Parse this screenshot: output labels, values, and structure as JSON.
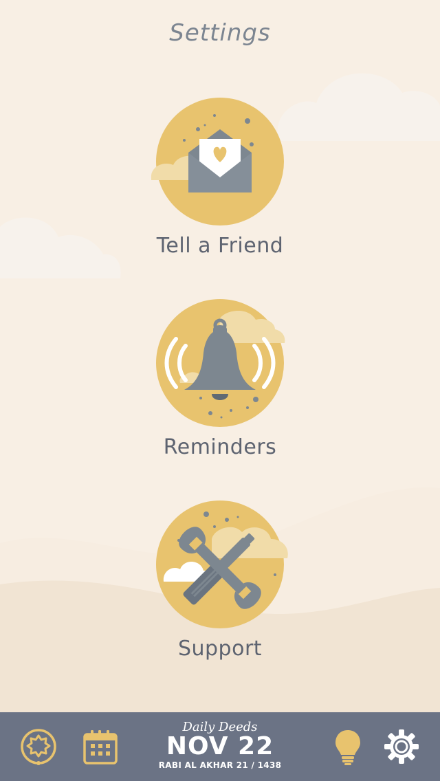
{
  "header": {
    "title": "Settings"
  },
  "menu": [
    {
      "label": "Tell a Friend",
      "icon": "envelope-heart-icon"
    },
    {
      "label": "Reminders",
      "icon": "bell-icon"
    },
    {
      "label": "Support",
      "icon": "wrench-screwdriver-icon"
    }
  ],
  "tabbar": {
    "app_name": "Daily Deeds",
    "date": "NOV 22",
    "hijri": "RABI AL AKHAR 21 / 1438",
    "icons": [
      "badge-icon",
      "calendar-icon",
      "lightbulb-icon",
      "gear-icon"
    ]
  },
  "colors": {
    "background": "#f8efe4",
    "accent": "#e8c36e",
    "icon_gray": "#7d8790",
    "tabbar": "#6b7385",
    "label": "#5d6370"
  }
}
